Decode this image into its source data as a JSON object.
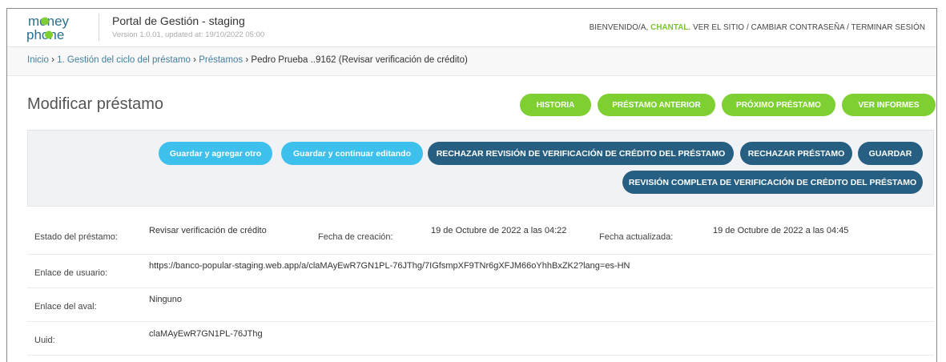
{
  "header": {
    "logo": {
      "line1": "money",
      "line2": "phone"
    },
    "portal_title": "Portal de Gestión - staging",
    "version": "Version 1.0.01, updated at: 19/10/2022 05:00",
    "welcome": "BIENVENIDO/A,",
    "user_name": "CHANTAL",
    "view_site": "VER EL SITIO",
    "change_password": "CAMBIAR CONTRASEÑA",
    "logout": "TERMINAR SESIÓN",
    "separator": "/"
  },
  "breadcrumbs": {
    "home": "Inicio",
    "section": "1. Gestión del ciclo del préstamo",
    "model": "Préstamos",
    "current": "Pedro Prueba ..9162 (Revisar verificación de crédito)",
    "sep": "›"
  },
  "page": {
    "title": "Modificar préstamo"
  },
  "object_tools": {
    "history": "HISTORIA",
    "previous_loan": "PRÉSTAMO ANTERIOR",
    "next_loan": "PRÓXIMO PRÉSTAMO",
    "view_reports": "VER INFORMES"
  },
  "submit_row": {
    "save_add_another": "Guardar y agregar otro",
    "save_continue": "Guardar y continuar editando",
    "reject_credit_review": "RECHAZAR REVISIÓN DE VERIFICACIÓN DE CRÉDITO DEL PRÉSTAMO",
    "reject_loan": "RECHAZAR PRÉSTAMO",
    "save": "GUARDAR",
    "complete_credit_review": "REVISIÓN COMPLETA DE VERIFICACIÓN DE CRÉDITO DEL PRÉSTAMO"
  },
  "fields": {
    "status_label": "Estado del préstamo:",
    "status_value": "Revisar verificación de crédito",
    "created_label": "Fecha de creación:",
    "created_value": "19 de Octubre de 2022 a las 04:22",
    "updated_label": "Fecha actualizada:",
    "updated_value": "19 de Octubre de 2022 a las 04:45",
    "user_link_label": "Enlace de usuario:",
    "user_link_value": "https://banco-popular-staging.web.app/a/claMAyEwR7GN1PL-76JThg/7IGfsmpXF9TNr6gXFJM66oYhhBxZK2?lang=es-HN",
    "guarantor_label": "Enlace del aval:",
    "guarantor_value": "Ninguno",
    "uuid_label": "Uuid:",
    "uuid_value": "claMAyEwR7GN1PL-76JThg"
  },
  "colors": {
    "brand_green": "#7ed032",
    "accent_cyan": "#3ec0ec",
    "dark_blue": "#275f82",
    "link_blue": "#447e9b",
    "logo_blue": "#2a6f8e"
  }
}
